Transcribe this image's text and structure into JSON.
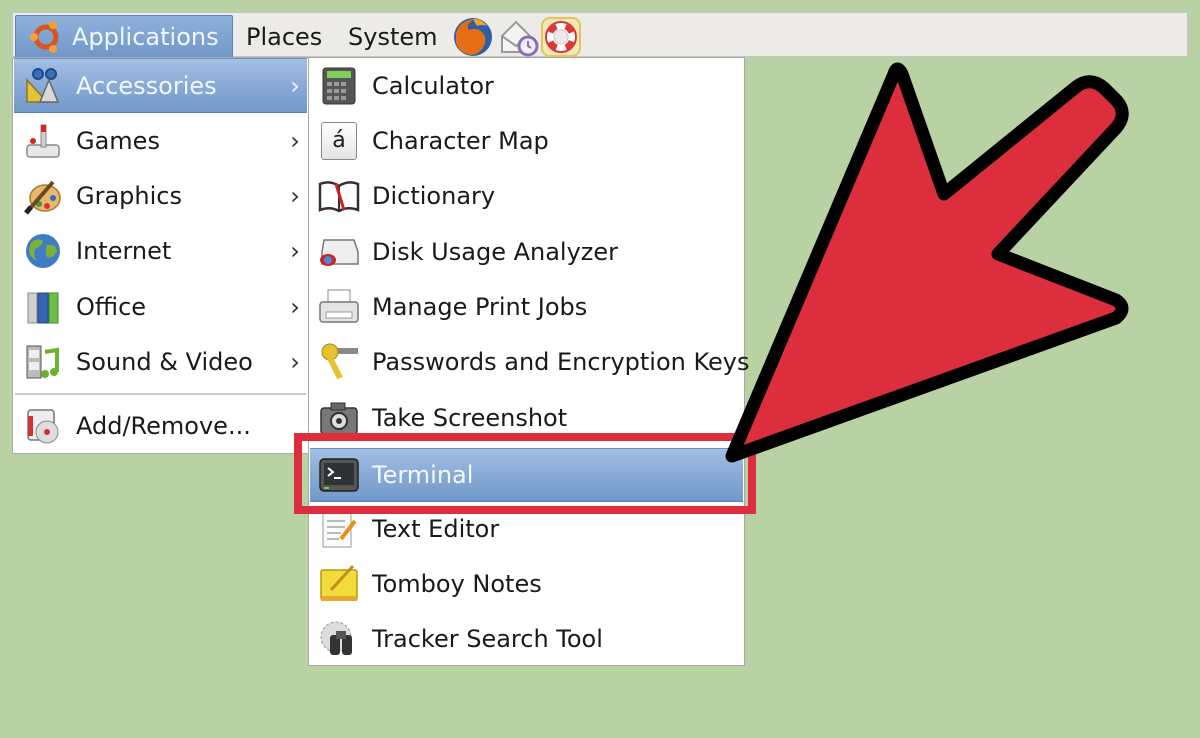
{
  "panel": {
    "menus": [
      {
        "label": "Applications",
        "icon": "ubuntu-logo-icon",
        "active": true
      },
      {
        "label": "Places"
      },
      {
        "label": "System"
      }
    ],
    "launchers": [
      {
        "icon": "firefox-icon"
      },
      {
        "icon": "mail-clock-icon"
      },
      {
        "icon": "help-lifebuoy-icon"
      }
    ]
  },
  "applications_menu": {
    "items": [
      {
        "label": "Accessories",
        "icon": "accessories-icon",
        "submenu": true,
        "highlighted": true
      },
      {
        "label": "Games",
        "icon": "games-joystick-icon",
        "submenu": true
      },
      {
        "label": "Graphics",
        "icon": "graphics-palette-icon",
        "submenu": true
      },
      {
        "label": "Internet",
        "icon": "internet-globe-icon",
        "submenu": true
      },
      {
        "label": "Office",
        "icon": "office-binders-icon",
        "submenu": true
      },
      {
        "label": "Sound & Video",
        "icon": "sound-video-icon",
        "submenu": true
      }
    ],
    "footer_item": {
      "label": "Add/Remove...",
      "icon": "add-remove-icon"
    },
    "chevron": "›"
  },
  "accessories_submenu": {
    "items": [
      {
        "label": "Calculator",
        "icon": "calculator-icon"
      },
      {
        "label": "Character Map",
        "icon": "character-map-icon",
        "glyph": "á"
      },
      {
        "label": "Dictionary",
        "icon": "dictionary-icon"
      },
      {
        "label": "Disk Usage Analyzer",
        "icon": "disk-usage-icon"
      },
      {
        "label": "Manage Print Jobs",
        "icon": "printer-icon"
      },
      {
        "label": "Passwords and Encryption Keys",
        "icon": "keys-icon"
      },
      {
        "label": "Take Screenshot",
        "icon": "camera-icon"
      },
      {
        "label": "Terminal",
        "icon": "terminal-icon",
        "highlighted": true
      },
      {
        "label": "Text Editor",
        "icon": "text-editor-icon"
      },
      {
        "label": "Tomboy Notes",
        "icon": "tomboy-notes-icon"
      },
      {
        "label": "Tracker Search Tool",
        "icon": "tracker-search-icon"
      }
    ]
  },
  "annotation": {
    "target": "Terminal",
    "box_color": "#dc2e3c",
    "arrow_fill": "#dc2e3c",
    "arrow_stroke": "#000000"
  },
  "colors": {
    "desktop_bg": "#b8d2a4",
    "highlight": "#89aad6",
    "panel_bg": "#ecebe8"
  }
}
